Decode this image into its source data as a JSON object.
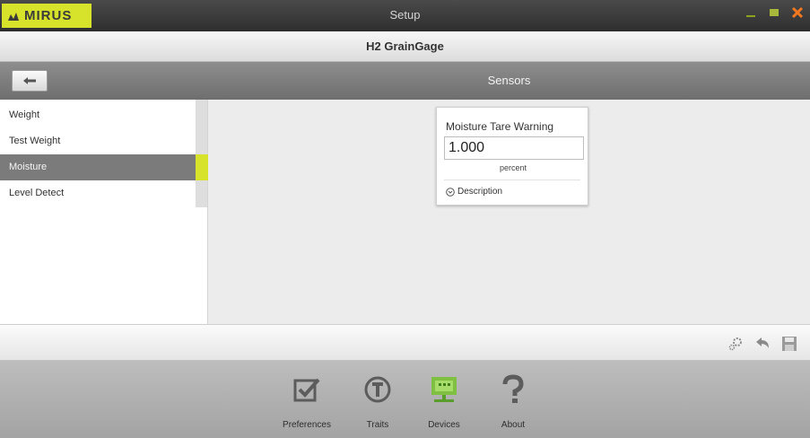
{
  "titlebar": {
    "logo_text": "MIRUS",
    "window_title": "Setup",
    "accent_color": "#d6e32a",
    "close_color": "#f07820"
  },
  "device": {
    "name": "H2 GrainGage"
  },
  "section": {
    "title": "Sensors"
  },
  "sidebar": {
    "items": [
      {
        "label": "Weight",
        "active": false
      },
      {
        "label": "Test Weight",
        "active": false
      },
      {
        "label": "Moisture",
        "active": true
      },
      {
        "label": "Level Detect",
        "active": false
      }
    ]
  },
  "card": {
    "title": "Moisture Tare Warning",
    "value": "1.000",
    "unit": "percent",
    "description_label": "Description"
  },
  "toolbar": {
    "icons": [
      "settings-icon",
      "undo-icon",
      "save-icon"
    ]
  },
  "bottom_nav": {
    "items": [
      {
        "label": "Preferences",
        "icon": "checkbox-icon",
        "active": false
      },
      {
        "label": "Traits",
        "icon": "traits-icon",
        "active": false
      },
      {
        "label": "Devices",
        "icon": "devices-icon",
        "active": true
      },
      {
        "label": "About",
        "icon": "question-icon",
        "active": false
      }
    ]
  }
}
